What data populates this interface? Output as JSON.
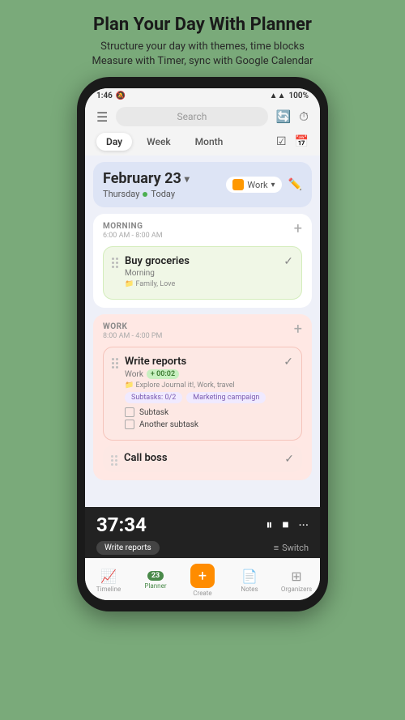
{
  "header": {
    "title": "Plan Your Day With Planner",
    "subtitle": "Structure your day with themes, time blocks\nMeasure with Timer, sync with Google Calendar"
  },
  "status_bar": {
    "time": "1:46",
    "battery": "100%",
    "signal_icons": "🔕"
  },
  "search": {
    "placeholder": "Search"
  },
  "tabs": {
    "items": [
      "Day",
      "Week",
      "Month"
    ],
    "active": "Day"
  },
  "date": {
    "title": "February 23",
    "day": "Thursday",
    "today_label": "Today",
    "work_label": "Work"
  },
  "morning_section": {
    "label": "MORNING",
    "time": "6:00 AM - 8:00 AM",
    "task": {
      "title": "Buy groceries",
      "label": "Morning",
      "tags": "Family,  Love"
    }
  },
  "work_section": {
    "label": "WORK",
    "time": "8:00 AM - 4:00 PM",
    "task1": {
      "title": "Write reports",
      "label": "Work",
      "timer_badge": "+ 00:02",
      "tags": "Explore Journal it!,  Work,  travel",
      "chip1": "Subtasks: 0/2",
      "chip2": "Marketing campaign",
      "subtask1": "Subtask",
      "subtask2": "Another subtask"
    },
    "task2": {
      "title": "Call boss"
    }
  },
  "timer": {
    "display": "37:34",
    "task_label": "Write reports",
    "switch_label": "Switch"
  },
  "nav": {
    "items": [
      {
        "label": "Timeline",
        "icon": "📈"
      },
      {
        "label": "Planner",
        "icon": "📅",
        "active": true,
        "badge": "23"
      },
      {
        "label": "Create",
        "icon": "+"
      },
      {
        "label": "Notes",
        "icon": "📄"
      },
      {
        "label": "Organizers",
        "icon": "⊞"
      }
    ]
  }
}
